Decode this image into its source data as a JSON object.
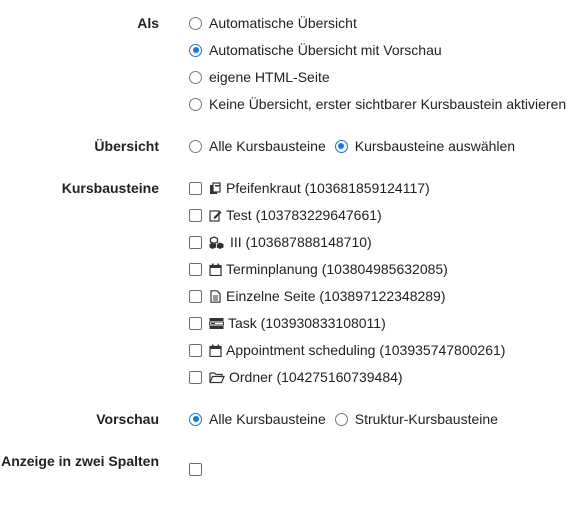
{
  "als": {
    "label": "Als",
    "options": [
      {
        "label": "Automatische Übersicht",
        "selected": false
      },
      {
        "label": "Automatische Übersicht mit Vorschau",
        "selected": true
      },
      {
        "label": "eigene HTML-Seite",
        "selected": false
      },
      {
        "label": "Keine Übersicht, erster sichtbarer Kursbaustein aktivieren",
        "selected": false
      }
    ]
  },
  "uebersicht": {
    "label": "Übersicht",
    "options": [
      {
        "label": "Alle Kursbausteine",
        "selected": false
      },
      {
        "label": "Kursbausteine auswählen",
        "selected": true
      }
    ]
  },
  "kursbausteine": {
    "label": "Kursbausteine",
    "items": [
      {
        "label": "Pfeifenkraut (103681859124117)",
        "icon": "copy-icon",
        "checked": false
      },
      {
        "label": "Test (103783229647661)",
        "icon": "edit-icon",
        "checked": false
      },
      {
        "label": "III (103687888148710)",
        "icon": "cubes-icon",
        "checked": false
      },
      {
        "label": "Terminplanung (103804985632085)",
        "icon": "calendar-icon",
        "checked": false
      },
      {
        "label": "Einzelne Seite (103897122348289)",
        "icon": "file-icon",
        "checked": false
      },
      {
        "label": "Task (103930833108011)",
        "icon": "tasks-icon",
        "checked": false
      },
      {
        "label": "Appointment scheduling (103935747800261)",
        "icon": "calendar-icon",
        "checked": false
      },
      {
        "label": "Ordner (104275160739484)",
        "icon": "folder-icon",
        "checked": false
      }
    ]
  },
  "vorschau": {
    "label": "Vorschau",
    "options": [
      {
        "label": "Alle Kursbausteine",
        "selected": true
      },
      {
        "label": "Struktur-Kursbausteine",
        "selected": false
      }
    ]
  },
  "zwei_spalten": {
    "label": "Anzeige in zwei Spalten",
    "checked": false
  },
  "colors": {
    "accent": "#1a73e8",
    "text": "#222222"
  }
}
